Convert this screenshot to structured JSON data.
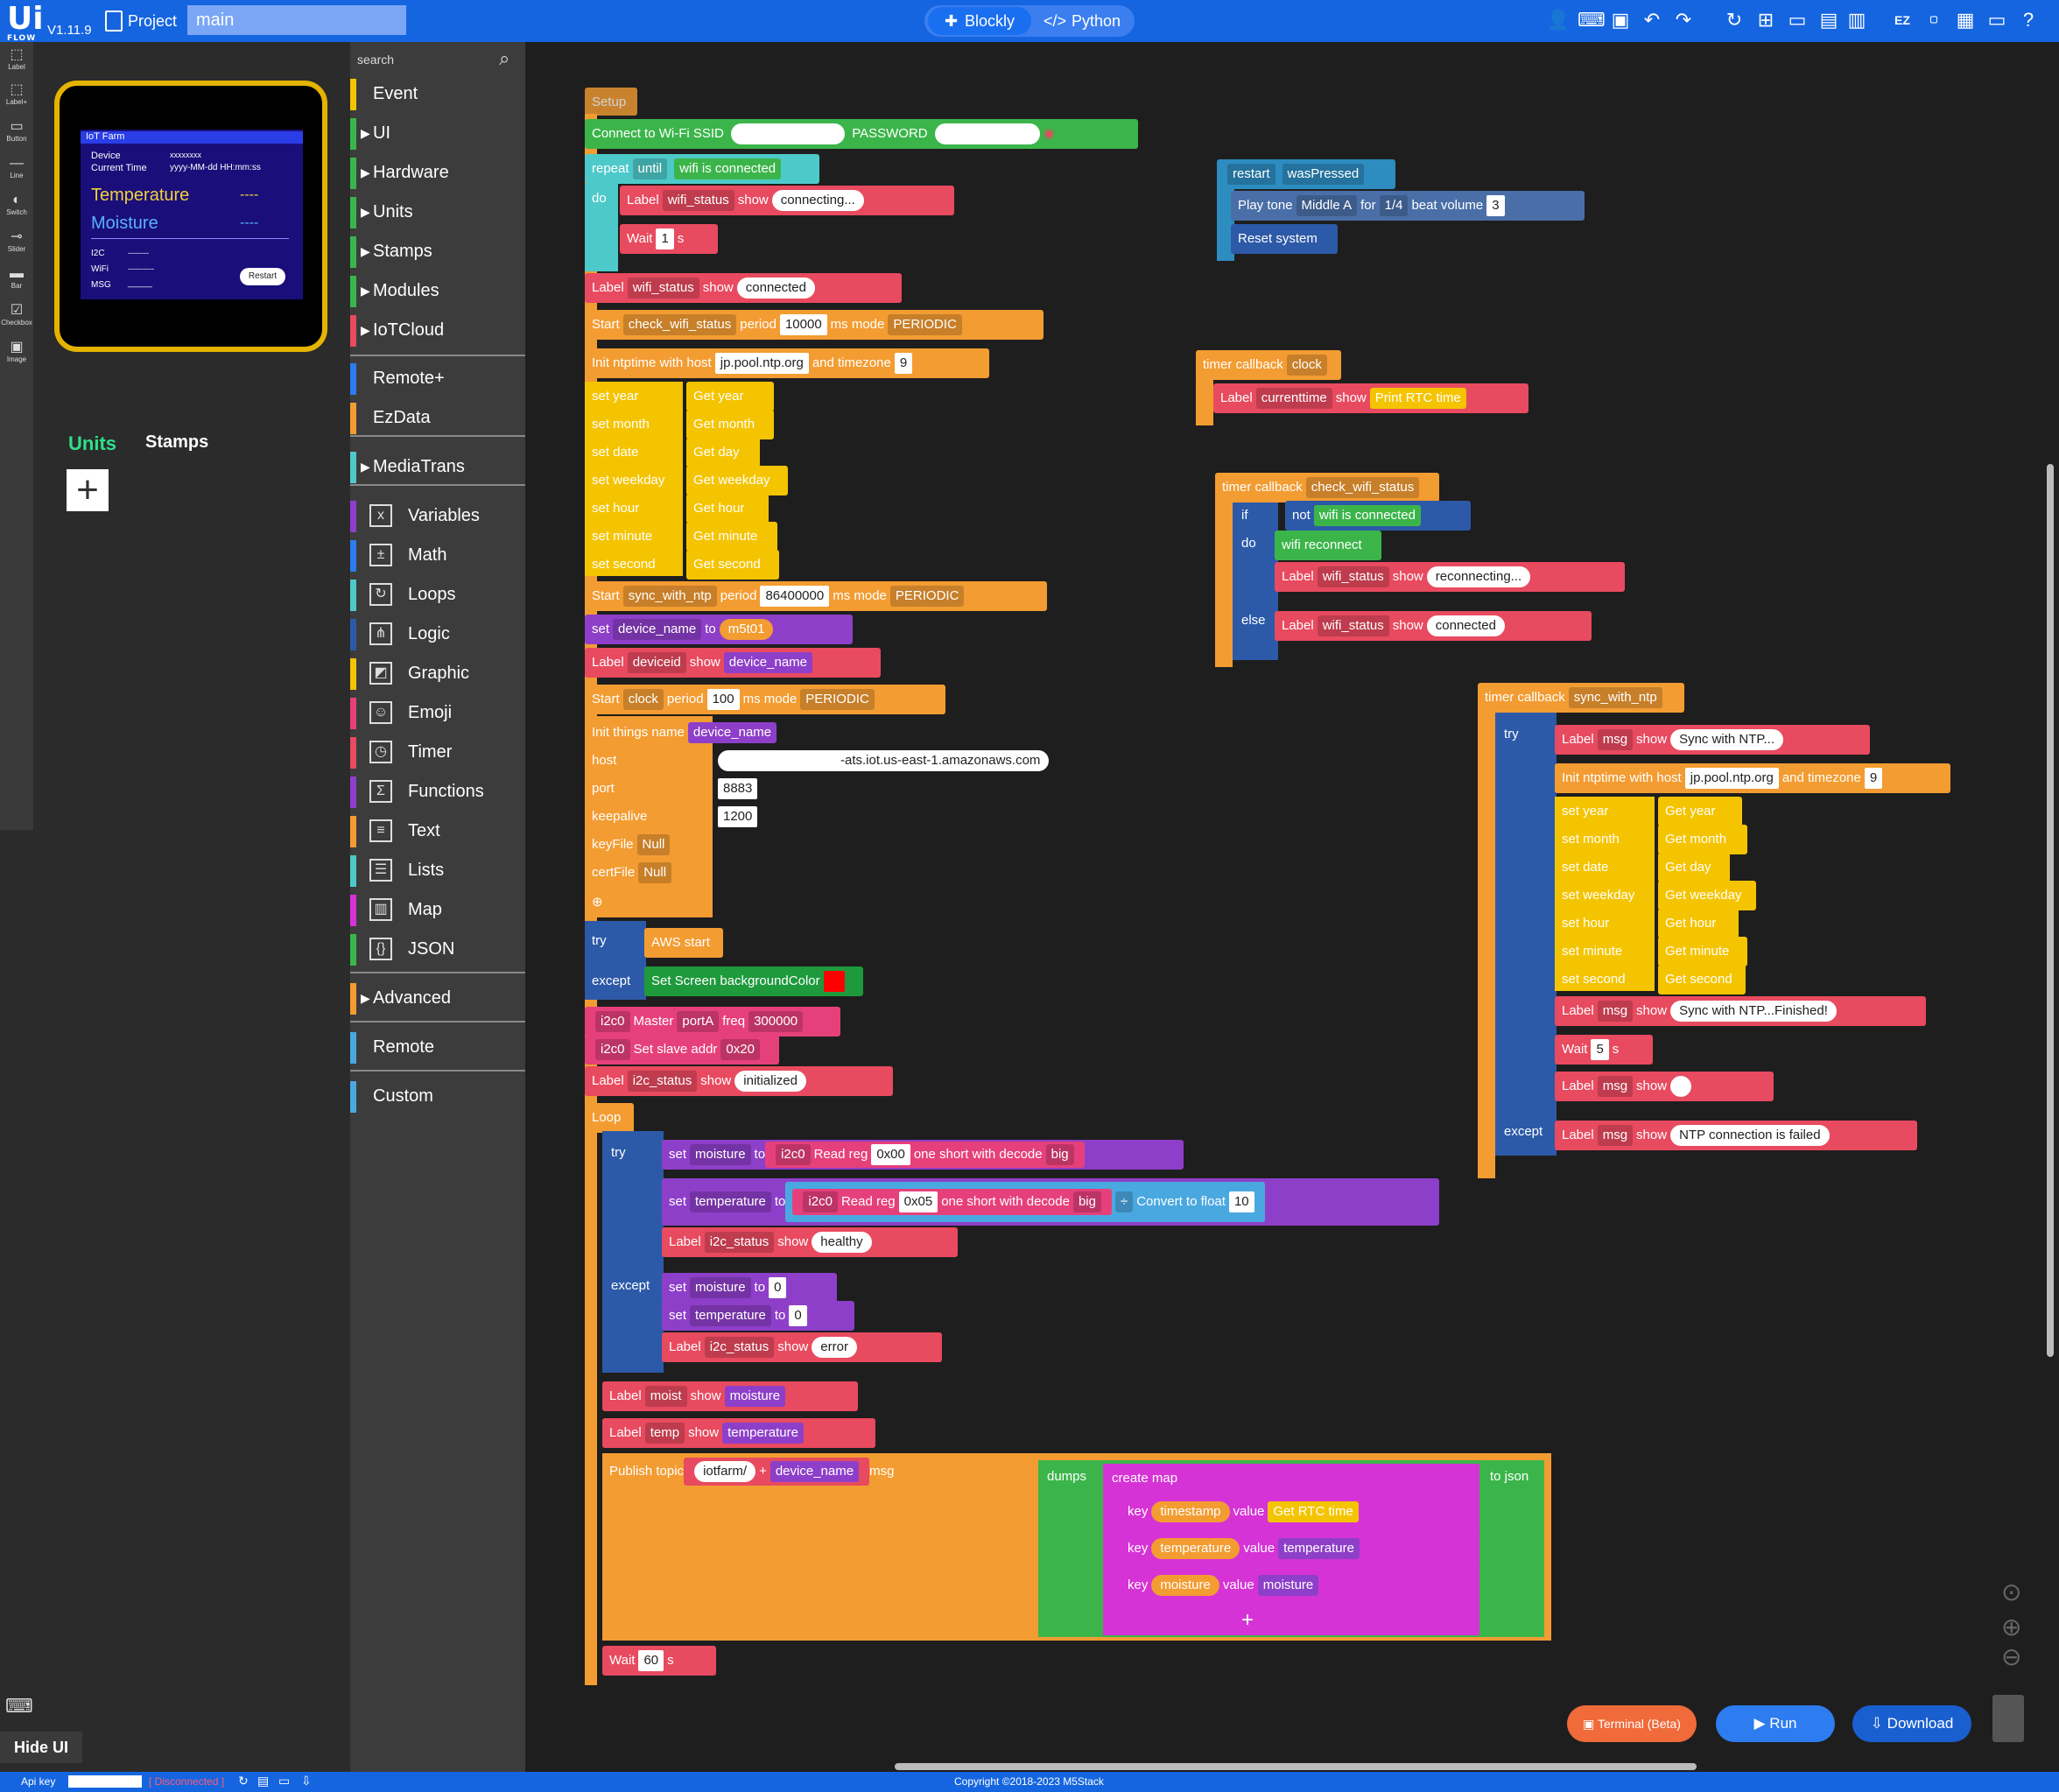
{
  "topbar": {
    "logo": "Ui",
    "logo_sub": "FLOW",
    "version": "V1.11.9",
    "project_label": "Project",
    "file_name": "main",
    "tab_blockly": "Blockly",
    "tab_python": "Python",
    "icons": [
      "user-icon",
      "keyboard-icon",
      "screen-icon",
      "undo-icon",
      "redo-icon",
      "refresh-icon",
      "add-file-icon",
      "open-folder-icon",
      "save-icon",
      "save-as-icon",
      "ezdata-icon",
      "demo-icon",
      "docs-icon",
      "chat-icon",
      "help-icon"
    ]
  },
  "lefttools": [
    {
      "name": "Label",
      "glyph": "⬚"
    },
    {
      "name": "Label+",
      "glyph": "⬚"
    },
    {
      "name": "Button",
      "glyph": "▭"
    },
    {
      "name": "Line",
      "glyph": "—"
    },
    {
      "name": "Switch",
      "glyph": "◐"
    },
    {
      "name": "Slider",
      "glyph": "⊸"
    },
    {
      "name": "Bar",
      "glyph": "▬"
    },
    {
      "name": "Checkbox",
      "glyph": "☑"
    },
    {
      "name": "Image",
      "glyph": "▣"
    }
  ],
  "preview": {
    "title": "IoT Farm",
    "device_label": "Device",
    "device_value": "xxxxxxxx",
    "time_label": "Current Time",
    "time_value": "yyyy-MM-dd HH:mm:ss",
    "temperature_label": "Temperature",
    "temperature_value": "----",
    "moisture_label": "Moisture",
    "moisture_value": "----",
    "i2c_label": "I2C",
    "i2c_value": "--------",
    "wifi_label": "WiFi",
    "wifi_value": "----------",
    "msg_label": "MSG",
    "msg_value": "_____",
    "restart_btn": "Restart"
  },
  "units_tab": "Units",
  "stamps_tab": "Stamps",
  "hide_ui": "Hide UI",
  "search_placeholder": "search",
  "categories": [
    {
      "label": "Event",
      "color": "#f5c400"
    },
    {
      "label": "UI",
      "color": "#3bb54a"
    },
    {
      "label": "Hardware",
      "color": "#3bb54a"
    },
    {
      "label": "Units",
      "color": "#3bb54a"
    },
    {
      "label": "Stamps",
      "color": "#3bb54a"
    },
    {
      "label": "Modules",
      "color": "#3bb54a"
    },
    {
      "label": "IoTCloud",
      "color": "#e84a5f"
    },
    {
      "label": "Remote+",
      "color": "#2d7cf0"
    },
    {
      "label": "EzData",
      "color": "#f39c32"
    },
    {
      "label": "MediaTrans",
      "color": "#4ec9c9"
    },
    {
      "label": "Variables",
      "color": "#8e3fc9"
    },
    {
      "label": "Math",
      "color": "#2d7cf0"
    },
    {
      "label": "Loops",
      "color": "#4ec9c9"
    },
    {
      "label": "Logic",
      "color": "#2d5aa8"
    },
    {
      "label": "Graphic",
      "color": "#f5c400"
    },
    {
      "label": "Emoji",
      "color": "#e6407a"
    },
    {
      "label": "Timer",
      "color": "#e84a5f"
    },
    {
      "label": "Functions",
      "color": "#8e3fc9"
    },
    {
      "label": "Text",
      "color": "#f39c32"
    },
    {
      "label": "Lists",
      "color": "#4ec9c9"
    },
    {
      "label": "Map",
      "color": "#d633d6"
    },
    {
      "label": "JSON",
      "color": "#3bb54a"
    },
    {
      "label": "Advanced",
      "color": "#f39c32"
    },
    {
      "label": "Remote",
      "color": "#4aa8e0"
    },
    {
      "label": "Custom",
      "color": "#4aa8e0"
    }
  ],
  "blocks": {
    "setup": "Setup",
    "wifi_connect": "Connect to Wi-Fi SSID",
    "password": "PASSWORD",
    "repeat": "repeat",
    "until": "until",
    "wifi_is_connected": "wifi is connected",
    "do": "do",
    "label": "Label",
    "show": "show",
    "wifi_status": "wifi_status",
    "connecting": "connecting...",
    "wait": "Wait",
    "one": "1",
    "s": "s",
    "connected": "connected",
    "start": "Start",
    "check_wifi_status": "check_wifi_status",
    "period": "period",
    "p10000": "10000",
    "ms_mode": "ms mode",
    "periodic": "PERIODIC",
    "init_ntp": "Init ntptime with host",
    "ntp_host": "jp.pool.ntp.org",
    "and_timezone": "and timezone",
    "tz": "9",
    "set_year": "set year",
    "get_year": "Get year",
    "set_month": "set month",
    "get_month": "Get month",
    "set_date": "set date",
    "get_day": "Get day",
    "set_weekday": "set weekday",
    "get_weekday": "Get weekday",
    "set_hour": "set hour",
    "get_hour": "Get hour",
    "set_minute": "set minute",
    "get_minute": "Get minute",
    "set_second": "set second",
    "get_second": "Get second",
    "sync_with_ntp": "sync_with_ntp",
    "p86400000": "86400000",
    "set": "set",
    "to": "to",
    "device_name": "device_name",
    "m5t01": "m5t01",
    "deviceid": "deviceid",
    "clock": "clock",
    "p100": "100",
    "init_things": "Init things name",
    "host": "host",
    "host_value": "-ats.iot.us-east-1.amazonaws.com",
    "port": "port",
    "port_value": "8883",
    "keepalive": "keepalive",
    "keepalive_value": "1200",
    "keyfile": "keyFile",
    "certfile": "certFile",
    "null": "Null",
    "try": "try",
    "aws_start": "AWS start",
    "except": "except",
    "set_bg": "Set Screen backgroundColor",
    "i2c0": "i2c0",
    "master": "Master",
    "porta": "portA",
    "freq": "freq",
    "freq_value": "300000",
    "set_slave": "Set slave addr",
    "slave_addr": "0x20",
    "i2c_status": "i2c_status",
    "initialized": "initialized",
    "loop": "Loop",
    "moisture": "moisture",
    "temperature": "temperature",
    "read_reg": "Read reg",
    "reg0": "0x00",
    "reg5": "0x05",
    "one_short": "one short with decode",
    "big": "big",
    "div": "÷",
    "convert_float": "Convert to float",
    "ten": "10",
    "healthy": "healthy",
    "zero": "0",
    "error": "error",
    "moist": "moist",
    "temp": "temp",
    "publish_topic": "Publish topic",
    "iotfarm": "iotfarm/",
    "plus": "+",
    "msg": "msg",
    "dumps": "dumps",
    "create_map": "create map",
    "to_json": "to json",
    "key": "key",
    "value": "value",
    "timestamp": "timestamp",
    "get_rtc": "Get RTC time",
    "sixty": "60",
    "restart": "restart",
    "waspressed": "wasPressed",
    "play_tone": "Play tone",
    "middle_a": "Middle A",
    "for": "for",
    "quarter": "1/4",
    "beat_volume": "beat volume",
    "three": "3",
    "reset_system": "Reset system",
    "timer_callback": "timer callback",
    "currenttime": "currenttime",
    "print_rtc": "Print RTC time",
    "if": "if",
    "not": "not",
    "wifi_reconnect": "wifi reconnect",
    "reconnecting": "reconnecting...",
    "else": "else",
    "sync_ntp_msg": "Sync with NTP...",
    "sync_finished": "Sync with NTP...Finished!",
    "five": "5",
    "ntp_failed": "NTP connection is failed",
    "q": "“",
    "q2": "”"
  },
  "buttons": {
    "terminal": "Terminal (Beta)",
    "run": "Run",
    "download": "Download"
  },
  "status": {
    "api_key": "Api key",
    "disconnected": "Disconnected",
    "copyright": "Copyright ©2018-2023 M5Stack"
  }
}
